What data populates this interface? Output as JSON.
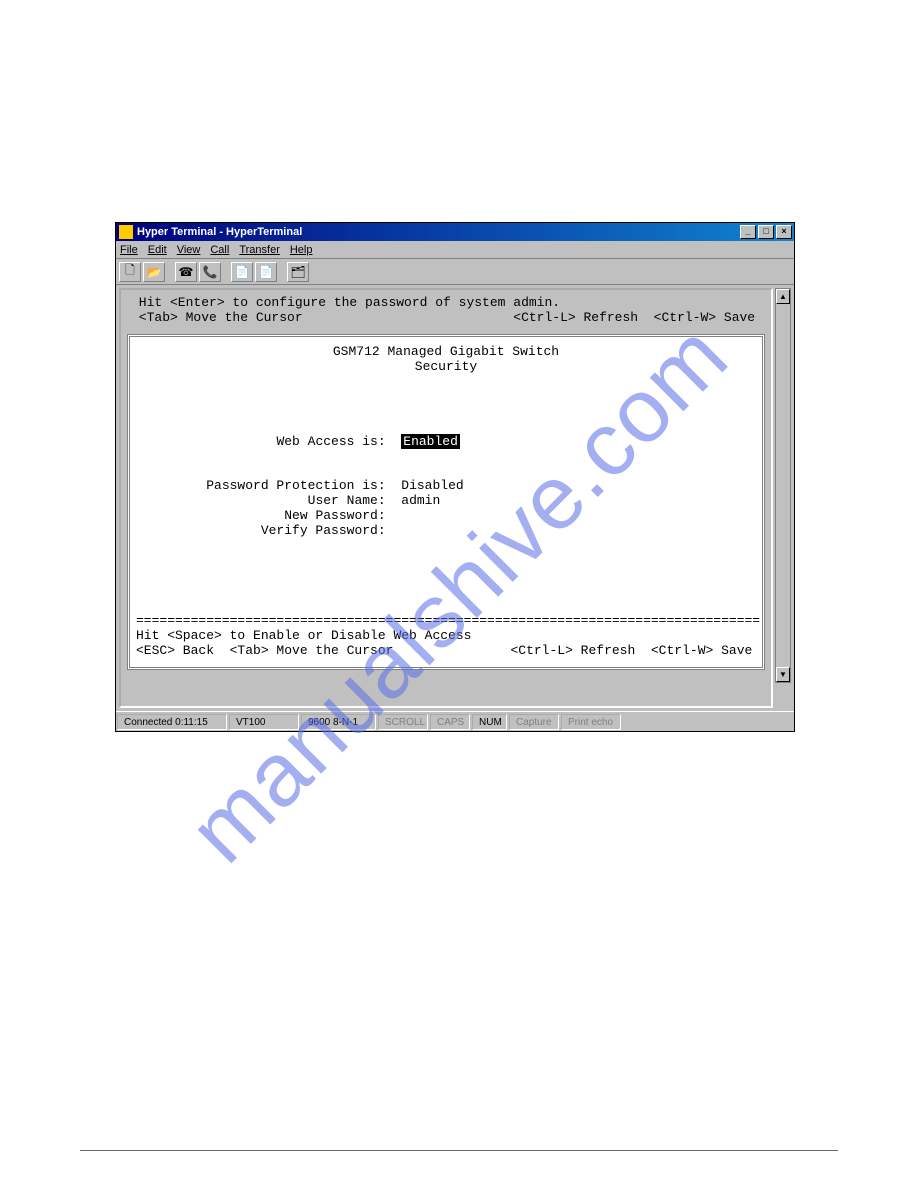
{
  "watermark": "manualshive.com",
  "window": {
    "title": "Hyper Terminal - HyperTerminal",
    "controls": {
      "min": "_",
      "max": "□",
      "close": "×"
    }
  },
  "menu": {
    "file": "File",
    "edit": "Edit",
    "view": "View",
    "call": "Call",
    "transfer": "Transfer",
    "help": "Help"
  },
  "toolbar": {
    "new": "🗋",
    "open": "📂",
    "connect": "☎",
    "disconnect": "📞",
    "send": "📄",
    "receive": "📄",
    "props": "🗂"
  },
  "terminal": {
    "hint1": " Hit <Enter> to configure the password of system admin.",
    "hint2": " <Tab> Move the Cursor                           <Ctrl-L> Refresh  <Ctrl-W> Save",
    "title1": "GSM712 Managed Gigabit Switch",
    "title2": "Security",
    "field_web_label": "Web Access is:",
    "field_web_value": "Enabled",
    "field_pwprot_label": "Password Protection is:",
    "field_pwprot_value": "Disabled",
    "field_user_label": "User Name:",
    "field_user_value": "admin",
    "field_newpw_label": "New Password:",
    "field_newpw_value": "",
    "field_verify_label": "Verify Password:",
    "field_verify_value": "",
    "divider": "================================================================================",
    "foot1": "Hit <Space> to Enable or Disable Web Access",
    "foot2": "<ESC> Back  <Tab> Move the Cursor               <Ctrl-L> Refresh  <Ctrl-W> Save"
  },
  "status": {
    "connected": "Connected 0:11:15",
    "emulation": "VT100",
    "settings": "9600 8-N-1",
    "scroll": "SCROLL",
    "caps": "CAPS",
    "num": "NUM",
    "capture": "Capture",
    "echo": "Print echo"
  }
}
